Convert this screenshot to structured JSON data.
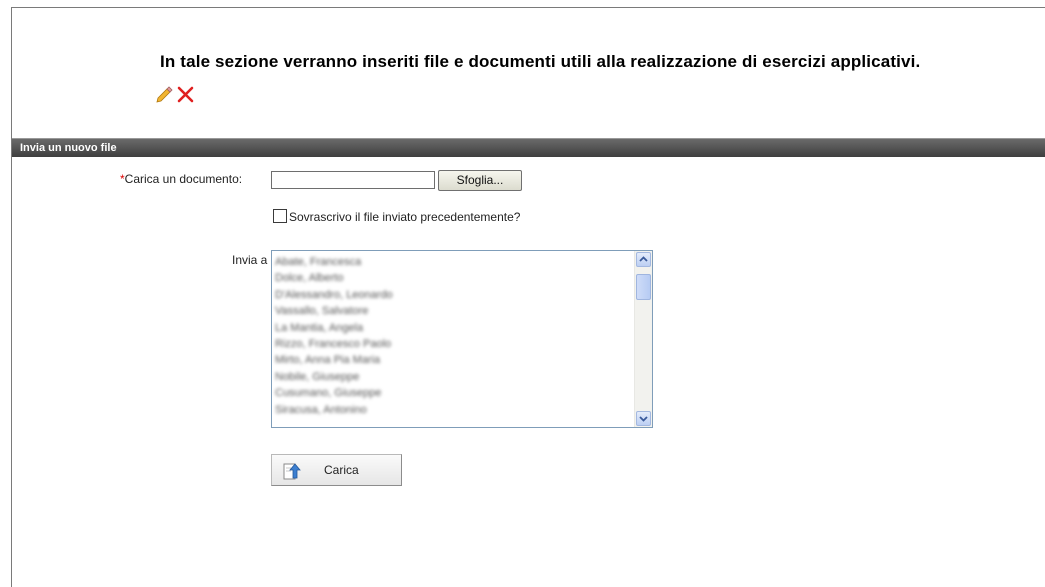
{
  "intro": {
    "text": "In tale sezione verranno inseriti file e documenti utili alla realizzazione di esercizi applicativi."
  },
  "tools": {
    "edit_icon": "pencil-icon",
    "delete_icon": "delete-x-icon",
    "delete_color": "#e02020"
  },
  "section": {
    "header": "Invia un nuovo file"
  },
  "form": {
    "required_marker": "*",
    "upload_label": "Carica un documento:",
    "file_value": "",
    "browse_label": "Sfoglia...",
    "overwrite_label": "Sovrascrivo il file inviato precedentemente?",
    "overwrite_checked": false,
    "send_to_label": "Invia a",
    "recipients": [
      "Abate, Francesca",
      "Dolce, Alberto",
      "D'Alessandro, Leonardo",
      "Vassallo, Salvatore",
      "La Mantia, Angela",
      "Rizzo, Francesco Paolo",
      "Mirto, Anna Pia Maria",
      "Nobile, Giuseppe",
      "Cusumano, Giuseppe",
      "Siracusa, Antonino"
    ],
    "submit_label": "Carica",
    "submit_icon": "upload-arrow-icon"
  },
  "colors": {
    "header_bar": "#4a4a4a",
    "required": "#dd0000",
    "listbox_border": "#7f9db9"
  }
}
